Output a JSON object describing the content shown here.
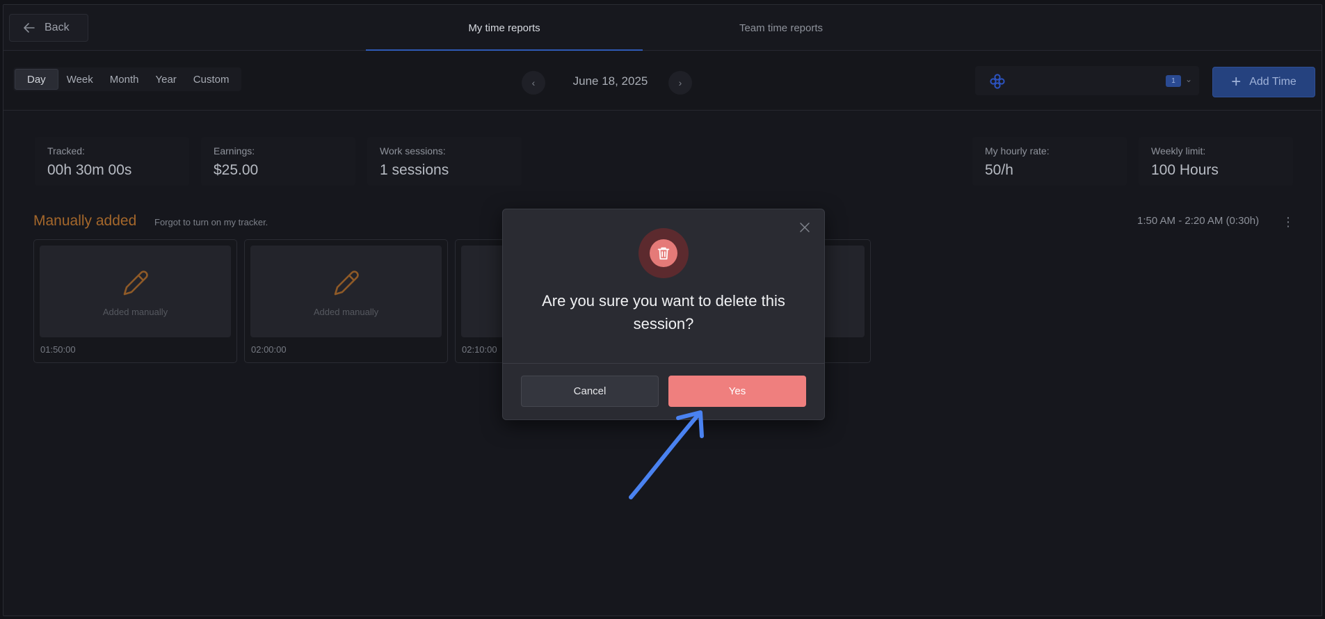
{
  "header": {
    "back_label": "Back",
    "tabs": [
      {
        "label": "My time reports",
        "active": true
      },
      {
        "label": "Team time reports",
        "active": false
      }
    ]
  },
  "filters": {
    "periods": [
      "Day",
      "Week",
      "Month",
      "Year",
      "Custom"
    ],
    "active_period": "Day",
    "date": "June 18, 2025",
    "workspace_count": "1",
    "add_time_label": "Add Time"
  },
  "stats": {
    "tracked": {
      "label": "Tracked:",
      "value": "00h 30m 00s"
    },
    "earnings": {
      "label": "Earnings:",
      "value": "$25.00"
    },
    "sessions": {
      "label": "Work sessions:",
      "value": "1 sessions"
    },
    "hourly_rate": {
      "label": "My hourly rate:",
      "value": "50/h"
    },
    "weekly_limit": {
      "label": "Weekly limit:",
      "value": "100 Hours"
    }
  },
  "section": {
    "title": "Manually added",
    "note": "Forgot to turn on my tracker.",
    "time_range": "1:50 AM - 2:20 AM (0:30h)",
    "cards": [
      {
        "caption": "Added manually",
        "time": "01:50:00"
      },
      {
        "caption": "Added manually",
        "time": "02:00:00"
      },
      {
        "caption": "",
        "time": "02:10:00"
      }
    ]
  },
  "modal": {
    "message": "Are you sure you want to delete this session?",
    "cancel_label": "Cancel",
    "confirm_label": "Yes"
  },
  "colors": {
    "accent_blue": "#2f5ab6",
    "danger": "#ef7f7e",
    "section_orange": "#a4672b",
    "annotation_arrow": "#4a82f0"
  }
}
